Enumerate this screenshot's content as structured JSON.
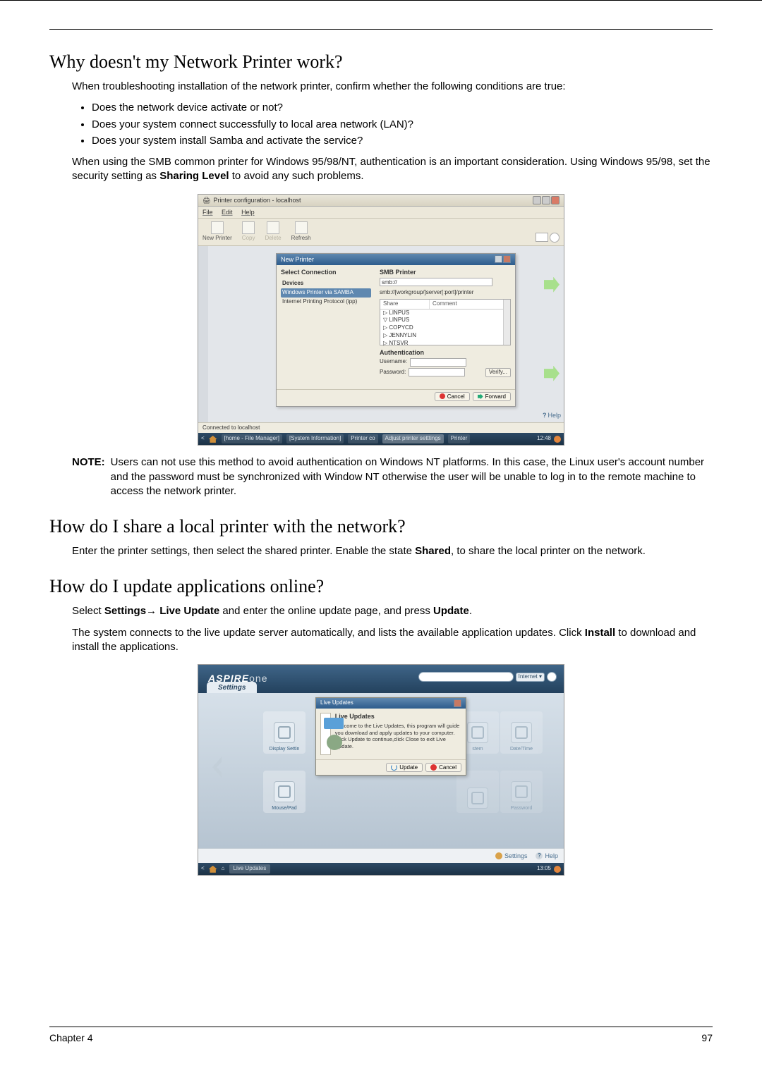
{
  "footer": {
    "left": "Chapter 4",
    "right": "97"
  },
  "sec1": {
    "heading": "Why doesn't my Network Printer work?",
    "intro": "When troubleshooting installation of the network printer, confirm whether the following conditions are true:",
    "bullets": [
      "Does the network device activate or not?",
      "Does your system connect successfully to local area network (LAN)?",
      "Does your system install Samba and activate the service?"
    ],
    "para_a": "When using the SMB common printer for Windows 95/98/NT, authentication is an important consideration. Using Windows 95/98, set the security setting as ",
    "para_bold": "Sharing Level",
    "para_b": " to avoid any such problems.",
    "note_label": "NOTE: ",
    "note_body": "Users can not use this method to avoid authentication on Windows NT platforms. In this case, the Linux user's account number and the password must be synchronized with Window NT otherwise the user will be unable to log in to the remote machine to access the network printer."
  },
  "sec2": {
    "heading": "How do I share a local printer with the network?",
    "text_a": "Enter the printer settings, then select the shared printer. Enable the state ",
    "text_bold": "Shared",
    "text_b": ", to share the local printer on the network."
  },
  "sec3": {
    "heading": "How do I update applications online?",
    "line1_a": "Select ",
    "line1_settings": "Settings",
    "line1_arrow": "→ ",
    "line1_live": "Live Update",
    "line1_b": " and enter the online update page, and press ",
    "line1_update": "Update",
    "line1_c": ".",
    "line2_a": "The system connects to the live update server automatically, and lists the available application updates. Click ",
    "line2_bold": "Install",
    "line2_b": " to download and install the applications."
  },
  "shot1": {
    "window_title": "Printer configuration - localhost",
    "menu": {
      "file": "File",
      "edit": "Edit",
      "help": "Help"
    },
    "toolbar": {
      "new_printer": "New Printer",
      "copy": "Copy",
      "delete": "Delete",
      "refresh": "Refresh"
    },
    "inner_title": "New Printer",
    "left": {
      "heading": "Select Connection",
      "devices": "Devices",
      "item_selected": "Windows Printer via SAMBA",
      "item_ipp": "Internet Printing Protocol (ipp)"
    },
    "right": {
      "heading": "SMB Printer",
      "smb_val": "smb://",
      "hint": "smb://[workgroup/]server[:port]/printer",
      "col_share": "Share",
      "col_comment": "Comment",
      "rows": [
        "▷ LINPUS",
        "▽ LINPUS",
        "   ▷ COPYCD",
        "   ▷ JENNYLIN",
        "   ▷ NTSVR"
      ],
      "auth": "Authentication",
      "user": "Username:",
      "pass": "Password:",
      "verify": "Verify..."
    },
    "btn_cancel": "Cancel",
    "btn_forward": "Forward",
    "status": "Connected to localhost",
    "help": "Help",
    "taskbar": {
      "t1": "[home - File Manager]",
      "t2": "[System Information]",
      "t3": "Printer co",
      "t4": "Adjust printer setttings",
      "t5": "Printer",
      "time": "12:48"
    }
  },
  "shot2": {
    "brand_a": "ASPIRE",
    "brand_b": "one",
    "search_mode": "Internet",
    "tab": "Settings",
    "cards": {
      "display": "Display Settin",
      "mouse": "Mouse/Pad",
      "sys": "stem",
      "date": "Date/Time",
      "pass": "Password"
    },
    "dialog": {
      "title": "Live Updates",
      "heading": "Live Updates",
      "body": "Welcome to the Live Updates, this program will guide you download and apply updates to your computer. Click Update to continue,click Close to exit Live Update.",
      "update": "Update",
      "cancel": "Cancel"
    },
    "bottom": {
      "settings": "Settings",
      "help": "Help"
    },
    "taskbar": {
      "task": "Live Updates",
      "time": "13:05"
    }
  }
}
